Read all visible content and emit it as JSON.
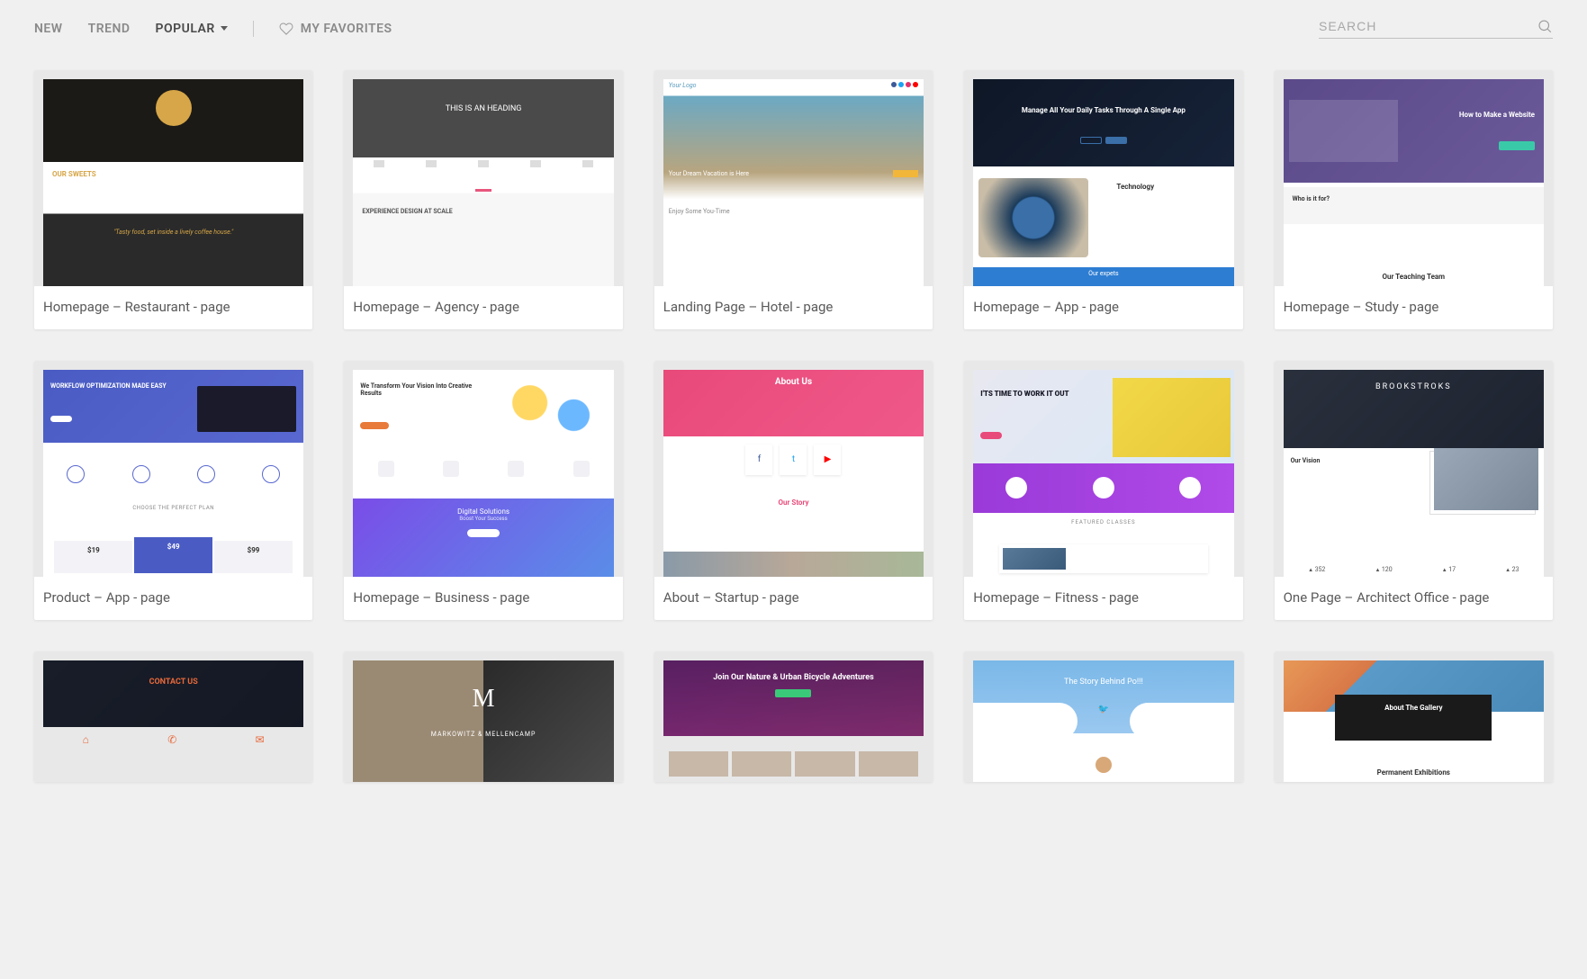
{
  "nav": {
    "new": "NEW",
    "trend": "TREND",
    "popular": "POPULAR",
    "favorites": "MY FAVORITES"
  },
  "search": {
    "placeholder": "SEARCH"
  },
  "templates": [
    {
      "title": "Homepage – Restaurant - page",
      "thumb_class": "t-restaurant"
    },
    {
      "title": "Homepage – Agency - page",
      "thumb_class": "t-agency"
    },
    {
      "title": "Landing Page – Hotel - page",
      "thumb_class": "t-hotel"
    },
    {
      "title": "Homepage – App - page",
      "thumb_class": "t-app"
    },
    {
      "title": "Homepage – Study - page",
      "thumb_class": "t-study"
    },
    {
      "title": "Product – App - page",
      "thumb_class": "t-product"
    },
    {
      "title": "Homepage – Business - page",
      "thumb_class": "t-business"
    },
    {
      "title": "About – Startup - page",
      "thumb_class": "t-startup"
    },
    {
      "title": "Homepage – Fitness - page",
      "thumb_class": "t-fitness"
    },
    {
      "title": "One Page – Architect Office - page",
      "thumb_class": "t-arch"
    },
    {
      "title": "",
      "thumb_class": "t-contact",
      "partial": true
    },
    {
      "title": "",
      "thumb_class": "t-law",
      "partial": true
    },
    {
      "title": "",
      "thumb_class": "t-bike",
      "partial": true
    },
    {
      "title": "",
      "thumb_class": "t-story",
      "partial": true
    },
    {
      "title": "",
      "thumb_class": "t-gallery",
      "partial": true
    }
  ],
  "thumb_text": {
    "restaurant_tag": "\"Tasty food, set inside a lively coffee house.\"",
    "hotel_caption": "Your Dream Vacation is Here",
    "hotel_mid": "Enjoy Some You-Time",
    "hotel_logo": "Your Logo",
    "app_hero": "Manage All Your Daily Tasks Through A Single App",
    "app_tech": "Technology",
    "app_footer": "Our expets",
    "study_hero": "How to Make a Website",
    "study_band": "Who is it for?",
    "study_footer": "Our Teaching Team",
    "product_hero": "WORKFLOW OPTIMIZATION MADE EASY",
    "product_plan_title": "CHOOSE THE PERFECT PLAN",
    "product_p1": "$19",
    "product_p2": "$49",
    "product_p3": "$99",
    "business_top": "We Transform Your Vision Into Creative Results",
    "business_grad": "Digital Solutions",
    "business_grad_sub": "Boost Your Success",
    "startup_hero": "About Us",
    "startup_story": "Our Story",
    "fitness_top": "I'TS TIME\nTO WORK\nIT OUT",
    "fitness_feat": "FEATURED CLASSES",
    "arch_hero": "BROOKSTROKS",
    "arch_vision": "Our Vision",
    "arch_s1": "352",
    "arch_s2": "120",
    "arch_s3": "17",
    "arch_s4": "23",
    "contact_title": "CONTACT US",
    "law_name": "MARKOWITZ & MELLENCAMP",
    "bike_hero": "Join Our Nature & Urban Bicycle Adventures",
    "story_title": "The Story Behind Po!!!",
    "gallery_box": "About The Gallery",
    "gallery_foot": "Permanent Exhibitions"
  }
}
